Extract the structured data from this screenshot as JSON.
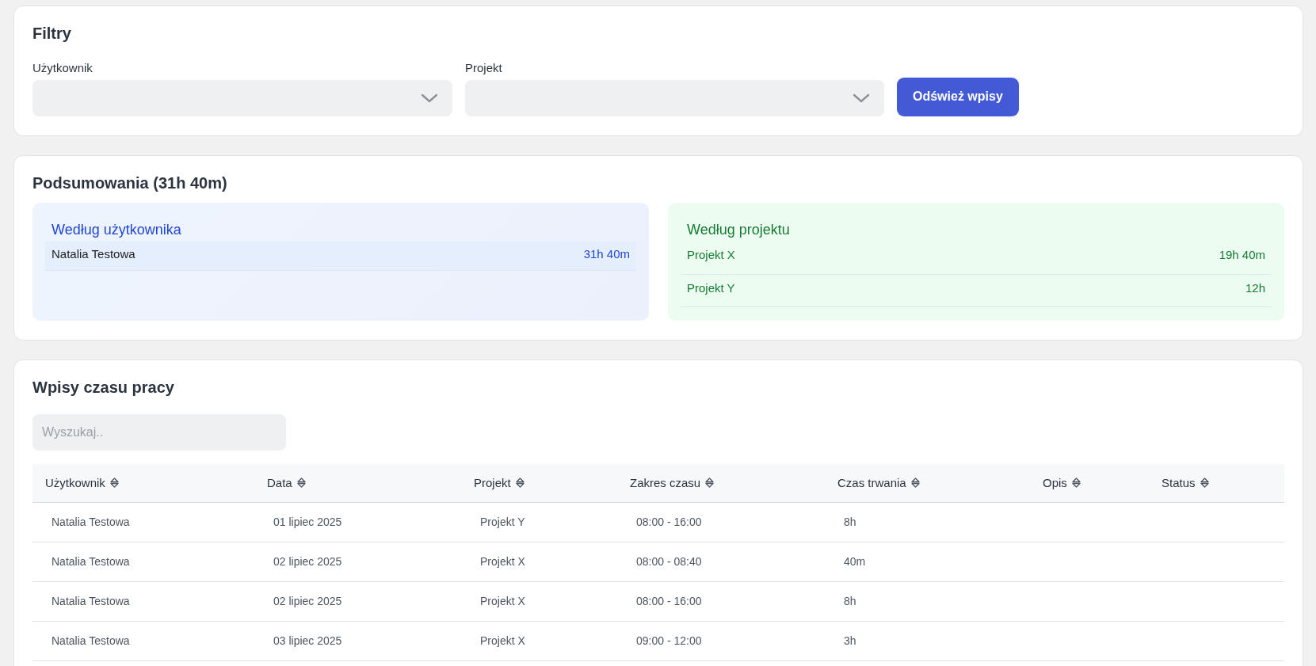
{
  "filters": {
    "title": "Filtry",
    "fields": [
      {
        "label": "Użytkownik"
      },
      {
        "label": "Projekt"
      }
    ],
    "refresh_button": "Odśwież wpisy"
  },
  "summary": {
    "title": "Podsumowania (31h 40m)",
    "panels": [
      {
        "kind": "user",
        "title": "Według użytkownika",
        "rows": [
          {
            "name": "Natalia Testowa",
            "total": "31h 40m"
          }
        ]
      },
      {
        "kind": "project",
        "title": "Według projektu",
        "rows": [
          {
            "name": "Projekt X",
            "total": "19h 40m"
          },
          {
            "name": "Projekt Y",
            "total": "12h"
          }
        ]
      }
    ]
  },
  "entries": {
    "title": "Wpisy czasu pracy",
    "search": {
      "placeholder": "Wyszukaj.."
    },
    "table": {
      "columns": [
        "Użytkownik",
        "Data",
        "Projekt",
        "Zakres czasu",
        "Czas trwania",
        "Opis",
        "Status"
      ],
      "rows": [
        [
          "Natalia Testowa",
          "01 lipiec 2025",
          "Projekt Y",
          "08:00 - 16:00",
          "8h",
          "",
          ""
        ],
        [
          "Natalia Testowa",
          "02 lipiec 2025",
          "Projekt X",
          "08:00 - 08:40",
          "40m",
          "",
          ""
        ],
        [
          "Natalia Testowa",
          "02 lipiec 2025",
          "Projekt X",
          "08:00 - 16:00",
          "8h",
          "",
          ""
        ],
        [
          "Natalia Testowa",
          "03 lipiec 2025",
          "Projekt X",
          "09:00 - 12:00",
          "3h",
          "",
          ""
        ]
      ]
    }
  }
}
